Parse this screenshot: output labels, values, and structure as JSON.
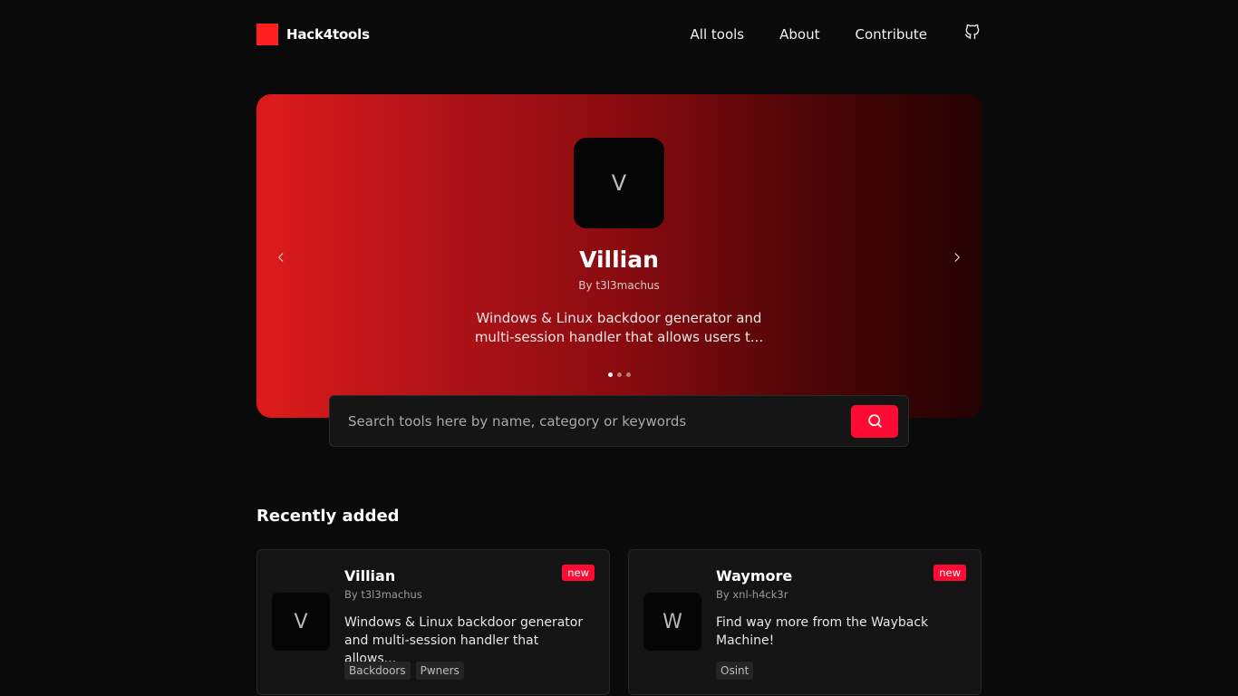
{
  "header": {
    "brand": "Hack4tools",
    "nav": [
      "All tools",
      "About",
      "Contribute"
    ],
    "github_icon": "github-icon"
  },
  "hero": {
    "avatar_letter": "V",
    "title": "Villian",
    "author": "By t3l3machus",
    "description": "Windows & Linux backdoor generator and multi-session handler that allows users t...",
    "slides_count": 3,
    "active_slide": 1,
    "prev_icon": "chevron-left-icon",
    "next_icon": "chevron-right-icon"
  },
  "search": {
    "placeholder": "Search tools here by name, category or keywords",
    "button_icon": "search-icon"
  },
  "recent": {
    "title": "Recently added",
    "cards": [
      {
        "avatar_letter": "V",
        "title": "Villian",
        "author": "By t3l3machus",
        "description": "Windows & Linux backdoor generator and multi-session handler that allows...",
        "badge": "new",
        "tags": [
          "Backdoors",
          "Pwners"
        ]
      },
      {
        "avatar_letter": "W",
        "title": "Waymore",
        "author": "By xnl-h4ck3r",
        "description": "Find way more from the Wayback Machine!",
        "badge": "new",
        "tags": [
          "Osint"
        ]
      }
    ]
  },
  "colors": {
    "brand": "#ff1f1f",
    "accent": "#ff0a33",
    "background": "#0a0a0a"
  }
}
